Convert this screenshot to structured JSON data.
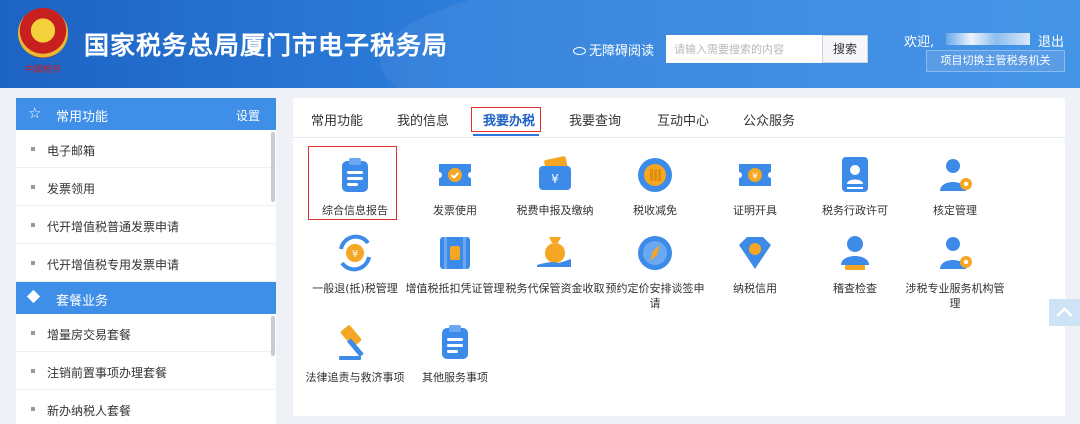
{
  "header": {
    "emblem_text": "中国税务",
    "title": "国家税务总局厦门市电子税务局",
    "accessibility_label": "无障碍阅读",
    "search": {
      "placeholder": "请输入需要搜索的内容",
      "button_label": "搜索"
    },
    "welcome_label": "欢迎,",
    "logout_label": "退出",
    "switch_authority_label": "项目切换主管税务机关"
  },
  "sidebar": {
    "sections": [
      {
        "title": "常用功能",
        "settings_label": "设置",
        "icon": "star-icon",
        "items": [
          "电子邮箱",
          "发票领用",
          "代开增值税普通发票申请",
          "代开增值税专用发票申请"
        ]
      },
      {
        "title": "套餐业务",
        "icon": "cube-icon",
        "items": [
          "增量房交易套餐",
          "注销前置事项办理套餐",
          "新办纳税人套餐"
        ]
      }
    ]
  },
  "tabs": [
    "常用功能",
    "我的信息",
    "我要办税",
    "我要查询",
    "互动中心",
    "公众服务"
  ],
  "active_tab": "我要办税",
  "services": [
    {
      "label": "综合信息报告",
      "icon": "clipboard-icon",
      "highlighted": true
    },
    {
      "label": "发票使用",
      "icon": "invoice-ticket-icon"
    },
    {
      "label": "税费申报及缴纳",
      "icon": "wallet-yuan-icon"
    },
    {
      "label": "税收减免",
      "icon": "coin-icon"
    },
    {
      "label": "证明开具",
      "icon": "certificate-icon"
    },
    {
      "label": "税务行政许可",
      "icon": "id-card-icon"
    },
    {
      "label": "核定管理",
      "icon": "user-gear-icon"
    },
    {
      "label": "一般退(抵)税管理",
      "icon": "yuan-refresh-icon"
    },
    {
      "label": "增值税抵扣凭证管理",
      "icon": "voucher-icon"
    },
    {
      "label": "税务代保管资金收取",
      "icon": "money-bag-hand-icon"
    },
    {
      "label": "预约定价安排谈签申请",
      "icon": "compass-icon"
    },
    {
      "label": "纳税信用",
      "icon": "diamond-shield-icon"
    },
    {
      "label": "稽查检查",
      "icon": "user-stamp-icon"
    },
    {
      "label": "涉税专业服务机构管理",
      "icon": "user-gear-icon"
    },
    {
      "label": "法律追责与救济事项",
      "icon": "gavel-icon"
    },
    {
      "label": "其他服务事项",
      "icon": "clipboard-icon"
    }
  ],
  "colors": {
    "brand_blue": "#2d79db",
    "highlight_red": "#e03030",
    "icon_orange": "#f5a623"
  }
}
